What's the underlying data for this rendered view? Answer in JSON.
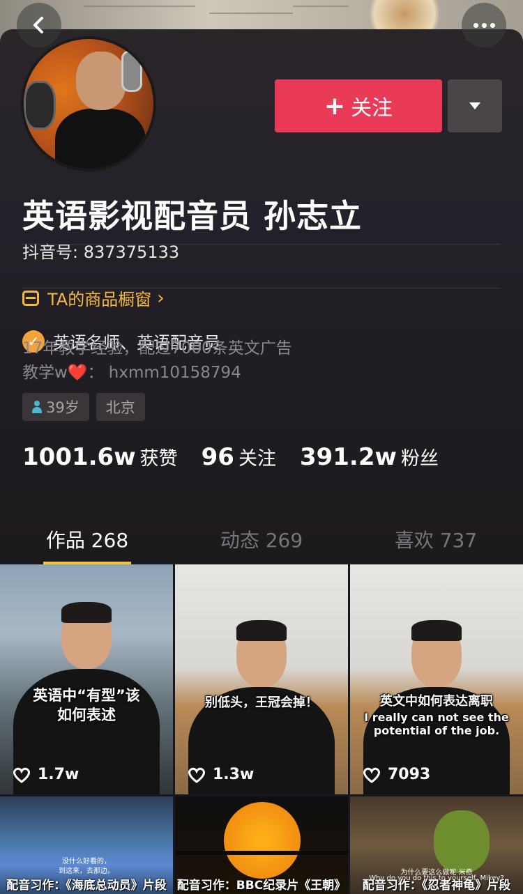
{
  "header": {
    "follow_label": "关注",
    "back_icon": "chevron-left-icon",
    "more_icon": "more-dots-icon",
    "dropdown_icon": "caret-down-icon"
  },
  "profile": {
    "name": "英语影视配音员 孙志立",
    "douyin_id": "抖音号: 837375133",
    "shop_label": "TA的商品橱窗",
    "verified": "英语名师、英语配音员",
    "bio_line1": "17年教学经验，配过7000条英文广告",
    "bio_line2_prefix": "教学w",
    "bio_line2_suffix": "： hxmm10158794",
    "tags": {
      "age": "39岁",
      "city": "北京"
    }
  },
  "stats": [
    {
      "num": "1001.6w",
      "label": "获赞"
    },
    {
      "num": "96",
      "label": "关注"
    },
    {
      "num": "391.2w",
      "label": "粉丝"
    }
  ],
  "tabs": [
    {
      "label": "作品 268"
    },
    {
      "label": "动态 269"
    },
    {
      "label": "喜欢 737"
    }
  ],
  "videos": [
    {
      "caption1": "英语中“有型”该",
      "caption2": "如何表述",
      "likes": "1.7w"
    },
    {
      "caption1": "别低头，王冠会掉！",
      "likes": "1.3w"
    },
    {
      "caption1": "英文中如何表达离职",
      "caption2": "I really can not see the",
      "caption3": "potential of the job.",
      "likes": "7093"
    },
    {
      "subtitle": "没什么好看的，",
      "subtitle2": "到这来，去那边。",
      "caption": "配音习作：《海底总动员》片段"
    },
    {
      "caption": "配音习作：BBC纪录片《王朝》"
    },
    {
      "subtitle": "为什么要这么做呢 米奇",
      "subtitle2": "Why do you do this to yourself, Mikey?",
      "caption": "配音习作：《忍者神龟》片段"
    }
  ],
  "colors": {
    "accent_red": "#e93b58",
    "accent_gold": "#f5b93d",
    "tab_indicator": "#f5c33b",
    "background": "#161823"
  }
}
